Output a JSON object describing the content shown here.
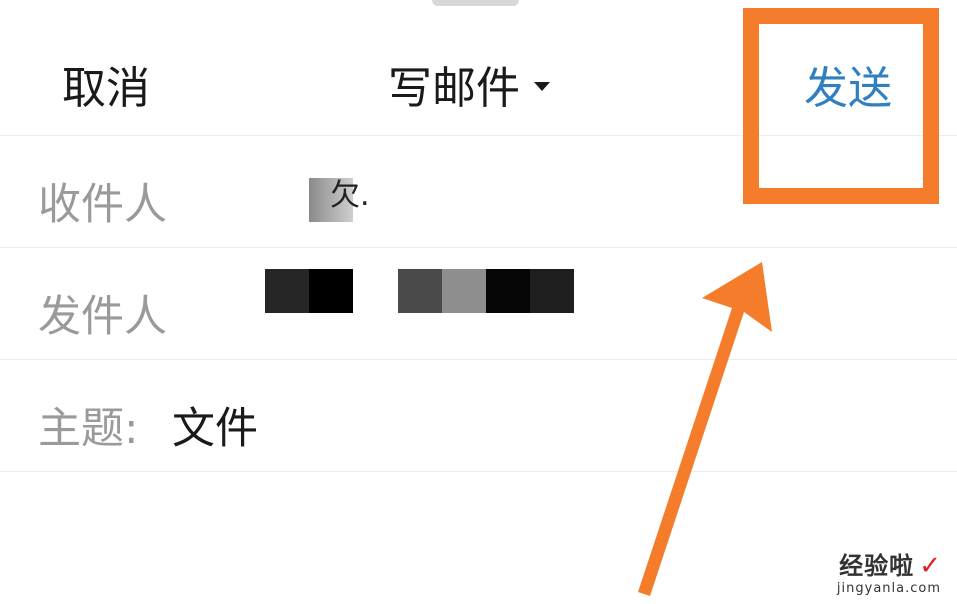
{
  "header": {
    "cancel_label": "取消",
    "title": "写邮件",
    "send_label": "发送"
  },
  "fields": {
    "recipient_label": "收件人",
    "recipient_fragment": "欠.",
    "sender_label": "发件人",
    "subject_label": "主题:",
    "subject_value": "文件"
  },
  "icons": {
    "title_dropdown": "caret-down-icon",
    "annotation_arrow": "arrow-up-right-icon"
  },
  "colors": {
    "send_accent": "#2f7fc1",
    "annotation": "#f47c2a",
    "label_gray": "#9a9a9a"
  },
  "watermark": {
    "brand": "经验啦",
    "check": "✓",
    "url": "jingyanla.com"
  }
}
